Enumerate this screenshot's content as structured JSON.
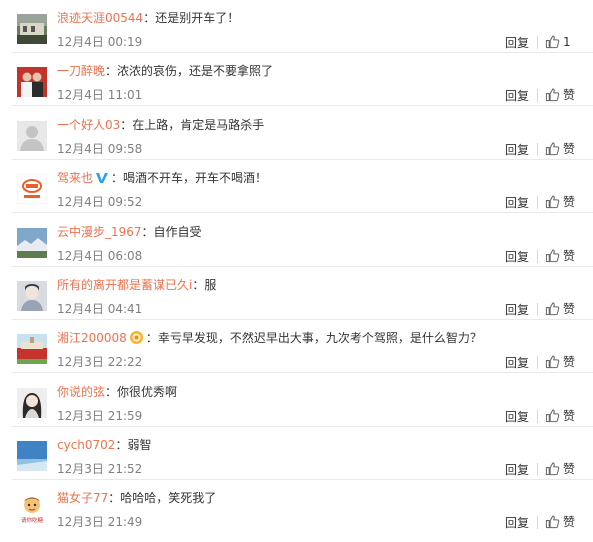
{
  "comments": [
    {
      "user": "浪迹天涯00544",
      "text": "：还是别开车了！",
      "time": "12月4日 00:19",
      "reply": "回复",
      "like": "1",
      "avatar_icon": "landscape-avatar",
      "badge": ""
    },
    {
      "user": "一刀醉晚",
      "text": "：浓浓的哀伤，还是不要拿照了",
      "time": "12月4日 11:01",
      "reply": "回复",
      "like": "赞",
      "avatar_icon": "couple-avatar",
      "badge": ""
    },
    {
      "user": "一个好人03",
      "text": "：在上路，肯定是马路杀手",
      "time": "12月4日 09:58",
      "reply": "回复",
      "like": "赞",
      "avatar_icon": "default-avatar",
      "badge": ""
    },
    {
      "user": "驾来也",
      "text": "：喝酒不开车，开车不喝酒！",
      "time": "12月4日 09:52",
      "reply": "回复",
      "like": "赞",
      "avatar_icon": "logo-avatar",
      "badge": "verified-v-icon"
    },
    {
      "user": "云中漫步_1967",
      "text": "：自作自受",
      "time": "12月4日 06:08",
      "reply": "回复",
      "like": "赞",
      "avatar_icon": "sky-avatar",
      "badge": ""
    },
    {
      "user": "所有的离开都是蓄谋已久i",
      "text": "：服",
      "time": "12月4日 04:41",
      "reply": "回复",
      "like": "赞",
      "avatar_icon": "portrait-avatar",
      "badge": ""
    },
    {
      "user": "湘江200008",
      "text": "：幸亏早发现，不然迟早出大事，九次考个驾照，是什么智力？",
      "time": "12月3日 22:22",
      "reply": "回复",
      "like": "赞",
      "avatar_icon": "stadium-avatar",
      "badge": "medal-icon"
    },
    {
      "user": "你说的弦",
      "text": "：你很优秀啊",
      "time": "12月3日 21:59",
      "reply": "回复",
      "like": "赞",
      "avatar_icon": "girl-avatar",
      "badge": ""
    },
    {
      "user": "cych0702",
      "text": "：弱智",
      "time": "12月3日 21:52",
      "reply": "回复",
      "like": "赞",
      "avatar_icon": "blue-sky-avatar",
      "badge": ""
    },
    {
      "user": "猫女子77",
      "text": "：哈哈哈，笑死我了",
      "time": "12月3日 21:49",
      "reply": "回复",
      "like": "赞",
      "avatar_icon": "cartoon-avatar",
      "badge": ""
    }
  ],
  "avatar_caption_drunk": "请你吃糖",
  "colors": {
    "username": "#eb7350",
    "time": "#808080",
    "text": "#333333",
    "verified": "#2aa0f0"
  }
}
